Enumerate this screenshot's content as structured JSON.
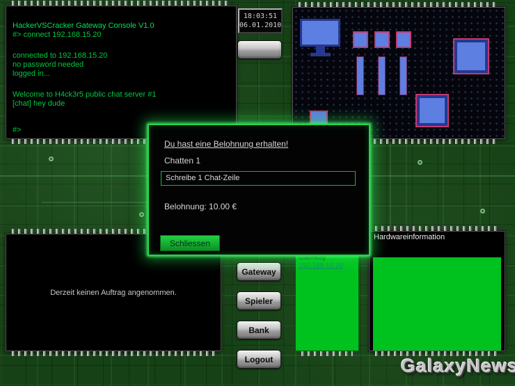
{
  "terminal": {
    "lines": [
      "HackerVSCracker Gateway Console V1.0",
      "#> connect 192.168.15.20",
      "",
      "connected to 192.168.15.20",
      "no password needed",
      "logged in...",
      "",
      "Welcome to H4ck3r5 public chat server #1",
      "[chat] hey dude"
    ],
    "prompt": "#>"
  },
  "clock": {
    "time": "18:03:51",
    "date": "06.01.2010"
  },
  "reward_dialog": {
    "title": "Du hast eine Belohnung erhalten!",
    "task": "Chatten 1",
    "description": "Schreibe 1 Chat-Zeile",
    "reward": "Belohnung: 10.00 €",
    "close_label": "Schliessen"
  },
  "mission_panel": {
    "message": "Derzeit keinen Auftrag angenommen."
  },
  "nav": {
    "gateway": "Gateway",
    "spieler": "Spieler",
    "bank": "Bank",
    "logout": "Logout"
  },
  "gateway_panel": {
    "title": "Gateway",
    "address": "192.168.15.20"
  },
  "hardware_panel": {
    "title": "Hardwareinformation"
  },
  "logo": "GalaxyNews",
  "colors": {
    "accent_green": "#00c21e",
    "terminal_green": "#00c840",
    "glow_green": "#2ad153"
  }
}
